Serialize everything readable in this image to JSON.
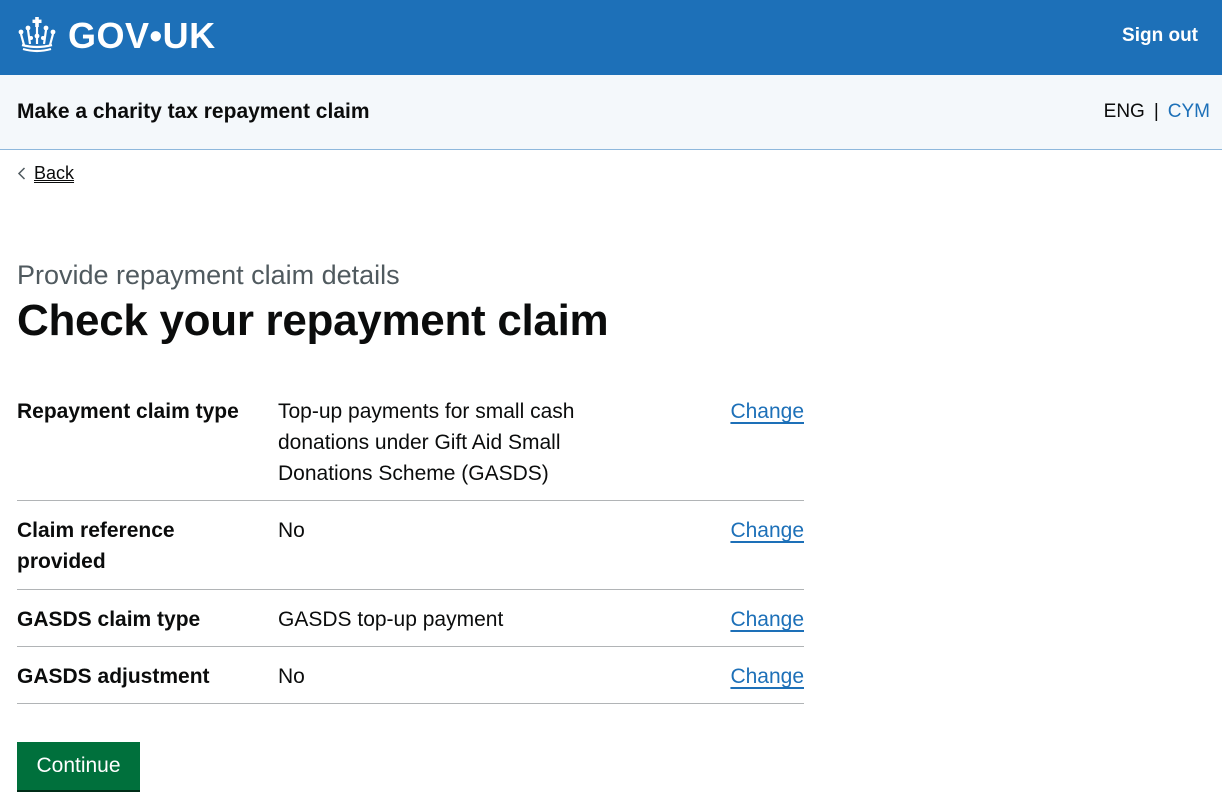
{
  "header": {
    "logo_text": "GOV•UK",
    "sign_out": "Sign out",
    "crown_icon": "crown-icon"
  },
  "service": {
    "name": "Make a charity tax repayment claim",
    "lang_eng": "ENG",
    "lang_sep": "|",
    "lang_cym": "CYM"
  },
  "back": {
    "label": "Back"
  },
  "page": {
    "caption": "Provide repayment claim details",
    "title": "Check your repayment claim"
  },
  "summary": {
    "rows": [
      {
        "key": "Repayment claim type",
        "value": "Top-up payments for small cash donations under Gift Aid Small Donations Scheme (GASDS)",
        "action": "Change"
      },
      {
        "key": "Claim reference provided",
        "value": "No",
        "action": "Change"
      },
      {
        "key": "GASDS claim type",
        "value": "GASDS top-up payment",
        "action": "Change"
      },
      {
        "key": "GASDS adjustment",
        "value": "No",
        "action": "Change"
      }
    ]
  },
  "continue_label": "Continue",
  "colors": {
    "header_blue": "#1d70b8",
    "link_blue": "#1d70b8",
    "button_green": "#00703c",
    "caption_grey": "#505a5f"
  }
}
